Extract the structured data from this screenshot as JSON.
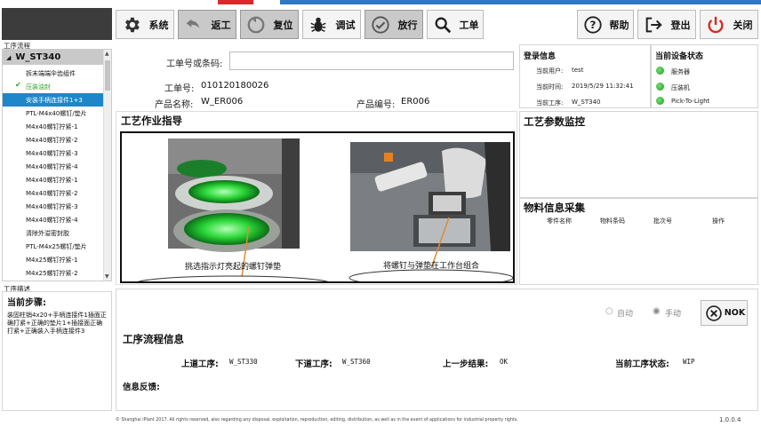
{
  "toolbar": {
    "system_label": "系统",
    "rework_label": "返工",
    "reset_label": "复位",
    "debug_label": "调试",
    "release_label": "放行",
    "order_label": "工单",
    "help_label": "帮助",
    "logout_label": "登出",
    "close_label": "关闭"
  },
  "process_tree": {
    "caption": "工序流程",
    "root": "W_ST340",
    "items": [
      "拆末端端伞齿组件",
      "压装油封",
      "安装手柄连接件1+3",
      "PTL-M4x40螺钉/垫片",
      "M4x40螺钉拧紧-1",
      "M4x40螺钉拧紧-2",
      "M4x40螺钉拧紧-3",
      "M4x40螺钉拧紧-4",
      "M4x40螺钉拧紧-1",
      "M4x40螺钉拧紧-2",
      "M4x40螺钉拧紧-3",
      "M4x40螺钉拧紧-4",
      "清除外溢密封胶",
      "PTL-M4x25螺钉/垫片",
      "M4x25螺钉拧紧-1",
      "M4x25螺钉拧紧-2"
    ]
  },
  "order_info": {
    "barcode_label": "工单号或条码:",
    "barcode_value": "",
    "order_no_label": "工单号:",
    "order_no_value": "010120180026",
    "product_name_label": "产品名称:",
    "product_name_value": "W_ER006",
    "product_no_label": "产品编号:",
    "product_no_value": "ER006"
  },
  "login_info": {
    "title": "登录信息",
    "user_label": "当前用户:",
    "user_value": "test",
    "time_label": "当前时间:",
    "time_value": "2019/5/29 11:32:41",
    "station_label": "当前工序:",
    "station_value": "W_ST340"
  },
  "device_status": {
    "title": "当前设备状态",
    "items": [
      "服务器",
      "压装机",
      "Pick-To-Light"
    ],
    "color": "#22aa22"
  },
  "work_instruction": {
    "title": "工艺作业指导",
    "caption_left": "挑选指示灯亮起的螺钉弹垫",
    "caption_right": "将螺钉与弹垫在工作台组合"
  },
  "param_monitor": {
    "title": "工艺参数监控"
  },
  "material": {
    "title": "物料信息采集",
    "columns": [
      "零件名称",
      "物料条码",
      "批次号",
      "操作"
    ]
  },
  "step_desc": {
    "caption": "工序描述",
    "title": "当前步骤:",
    "text": "装固柱销4x20+手柄连接件1插面正确打紧+正确的垫片1+插接面正确打紧+正确装入手柄连接件3"
  },
  "mode": {
    "auto_label": "自动",
    "manual_label": "手动",
    "selected": "manual",
    "nok_label": "NOK"
  },
  "flow_info": {
    "title": "工序流程信息",
    "prev_label": "上道工序:",
    "prev_value": "W_ST330",
    "next_label": "下道工序:",
    "next_value": "W_ST360",
    "last_result_label": "上一步结果:",
    "last_result_value": "OK",
    "status_label": "当前工序状态:",
    "status_value": "WIP",
    "feedback_label": "信息反馈:"
  },
  "footer": {
    "copyright": "© Shanghai iPlant 2017. All rights reserved, also regarding any disposal, exploitation, reproduction, editing, distribution, as well as in the event of applications for industrial property rights.",
    "version": "1.0.0.4"
  },
  "colors": {
    "accent_blue": "#1d87c9",
    "stripe_red": "#d92a2a",
    "stripe_blue": "#2f78c4",
    "power_red": "#d62b1f"
  }
}
